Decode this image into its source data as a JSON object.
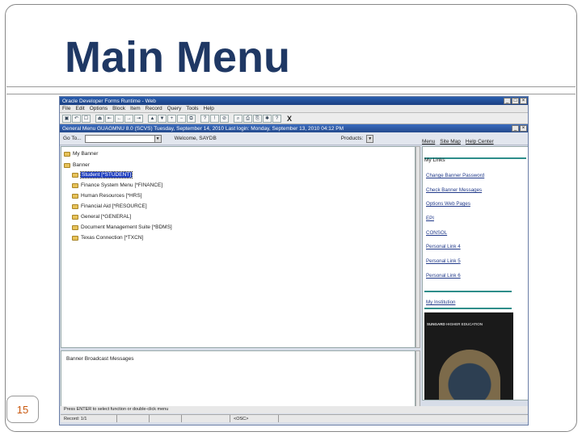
{
  "slide": {
    "title": "Main Menu",
    "page_number": "15"
  },
  "app": {
    "window_title": "Oracle Developer Forms Runtime - Web",
    "menu": [
      "File",
      "Edit",
      "Options",
      "Block",
      "Item",
      "Record",
      "Query",
      "Tools",
      "Help"
    ],
    "toolbar_close_label": "X",
    "form_title": "General Menu  GUAGMNU 8.0  (SCVS)  Tuesday, September 14, 2010  Last login: Monday, September 13, 2010 04:12 PM",
    "go_to_label": "Go To...",
    "welcome_label": "Welcome,  SAYDB",
    "products_label": "Products:",
    "top_links": [
      "Menu",
      "Site Map",
      "Help Center"
    ],
    "tree": {
      "my_banner": "My Banner",
      "banner": "Banner",
      "items": [
        "Student [*STUDENT]",
        "Finance System Menu [*FINANCE]",
        "Human Resources [*HRS]",
        "Financial Aid [*RESOURCE]",
        "General [*GENERAL]",
        "Document Management Suite [*BDMS]",
        "Texas Connection [*TXCN]"
      ]
    },
    "my_links": {
      "heading": "My Links",
      "items": [
        "Change Banner Password",
        "Check Banner Messages",
        "Options Web Pages",
        "EPI",
        "CONSOL",
        "Personal Link 4",
        "Personal Link 5",
        "Personal Link 6"
      ],
      "my_institution": "My Institution",
      "promo_brand": "SUNGARD",
      "promo_tag": "HIGHER EDUCATION"
    },
    "broadcast_label": "Banner Broadcast Messages",
    "status_line": "Press ENTER to select function or double-click menu",
    "status_cells": [
      "Record: 1/1",
      "",
      "",
      "",
      "<OSC>"
    ]
  }
}
